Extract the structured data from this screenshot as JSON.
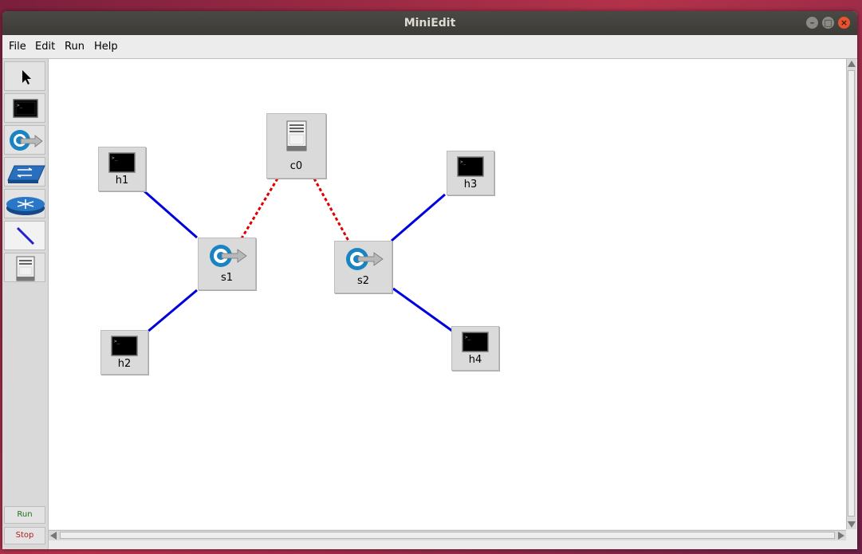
{
  "window": {
    "title": "MiniEdit"
  },
  "menu": {
    "file": "File",
    "edit": "Edit",
    "run": "Run",
    "help": "Help"
  },
  "toolbar": {
    "run_label": "Run",
    "stop_label": "Stop"
  },
  "nodes": {
    "h1": "h1",
    "h2": "h2",
    "h3": "h3",
    "h4": "h4",
    "s1": "s1",
    "s2": "s2",
    "c0": "c0"
  },
  "colors": {
    "data_link": "#0000dd",
    "control_link": "#dd0000",
    "run_text": "#207020",
    "stop_text": "#b02020"
  },
  "icons": {
    "select": "pointer-arrow-icon",
    "host": "terminal-icon",
    "switch": "openflow-switch-icon",
    "legacy_switch": "legacy-switch-icon",
    "router": "router-icon",
    "link": "link-line-icon",
    "controller": "server-icon"
  }
}
